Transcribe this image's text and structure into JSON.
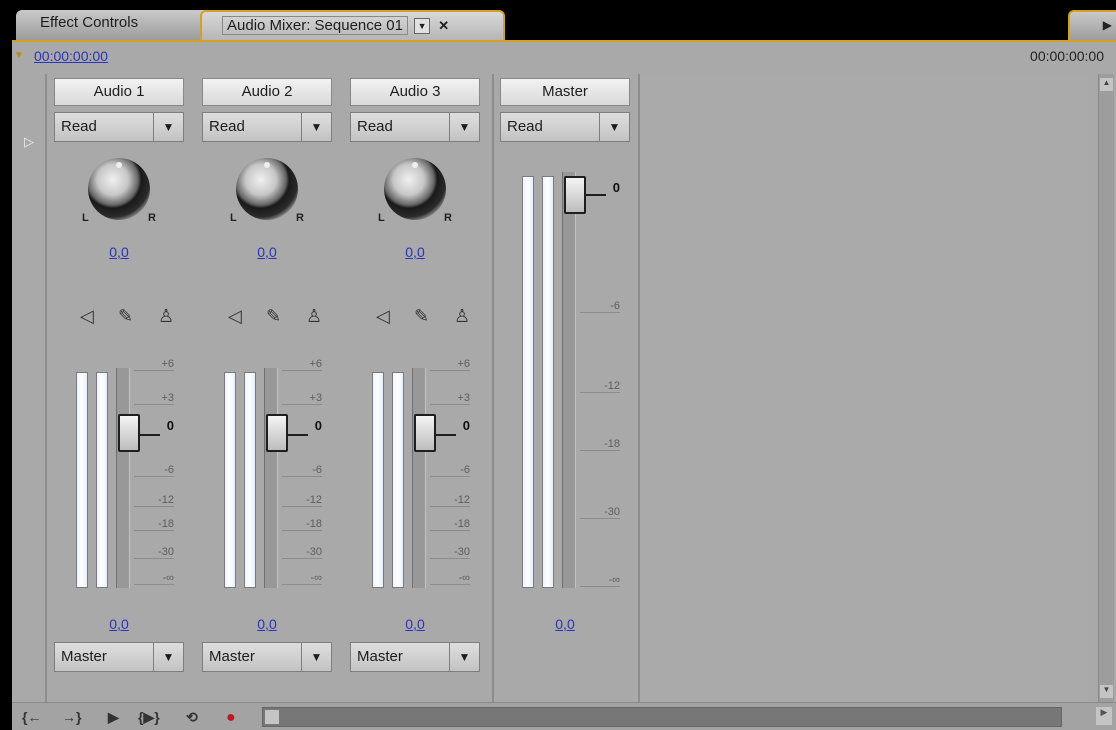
{
  "tabs": {
    "effect_controls": "Effect Controls",
    "audio_mixer": "Audio Mixer: Sequence 01",
    "menu_icon": "menu-triangle",
    "close_icon": "close-x"
  },
  "timecode": {
    "current": "00:00:00:00",
    "right": "00:00:00:00"
  },
  "channels": [
    {
      "name": "Audio 1",
      "automation": "Read",
      "pan_value": "0,0",
      "pan_left": "L",
      "pan_right": "R",
      "volume_value": "0,0",
      "output": "Master"
    },
    {
      "name": "Audio 2",
      "automation": "Read",
      "pan_value": "0,0",
      "pan_left": "L",
      "pan_right": "R",
      "volume_value": "0,0",
      "output": "Master"
    },
    {
      "name": "Audio 3",
      "automation": "Read",
      "pan_value": "0,0",
      "pan_left": "L",
      "pan_right": "R",
      "volume_value": "0,0",
      "output": "Master"
    }
  ],
  "master": {
    "name": "Master",
    "automation": "Read",
    "volume_value": "0,0"
  },
  "channel_scale": [
    "+6",
    "+3",
    "0",
    "-6",
    "-12",
    "-18",
    "-30",
    "-∞"
  ],
  "master_scale": [
    "0",
    "-6",
    "-12",
    "-18",
    "-30",
    "-∞"
  ],
  "icons": {
    "mute": "speaker-icon",
    "solo": "headphone-icon",
    "record": "microphone-icon"
  },
  "transport": {
    "go_in": "{←",
    "go_out": "→}",
    "play": "▶",
    "play_in_out": "{▶}",
    "loop": "loop-icon",
    "record": "record-icon"
  },
  "colors": {
    "panel": "#a9a9a9",
    "accent": "#d7a21b",
    "link": "#2a34b8"
  }
}
